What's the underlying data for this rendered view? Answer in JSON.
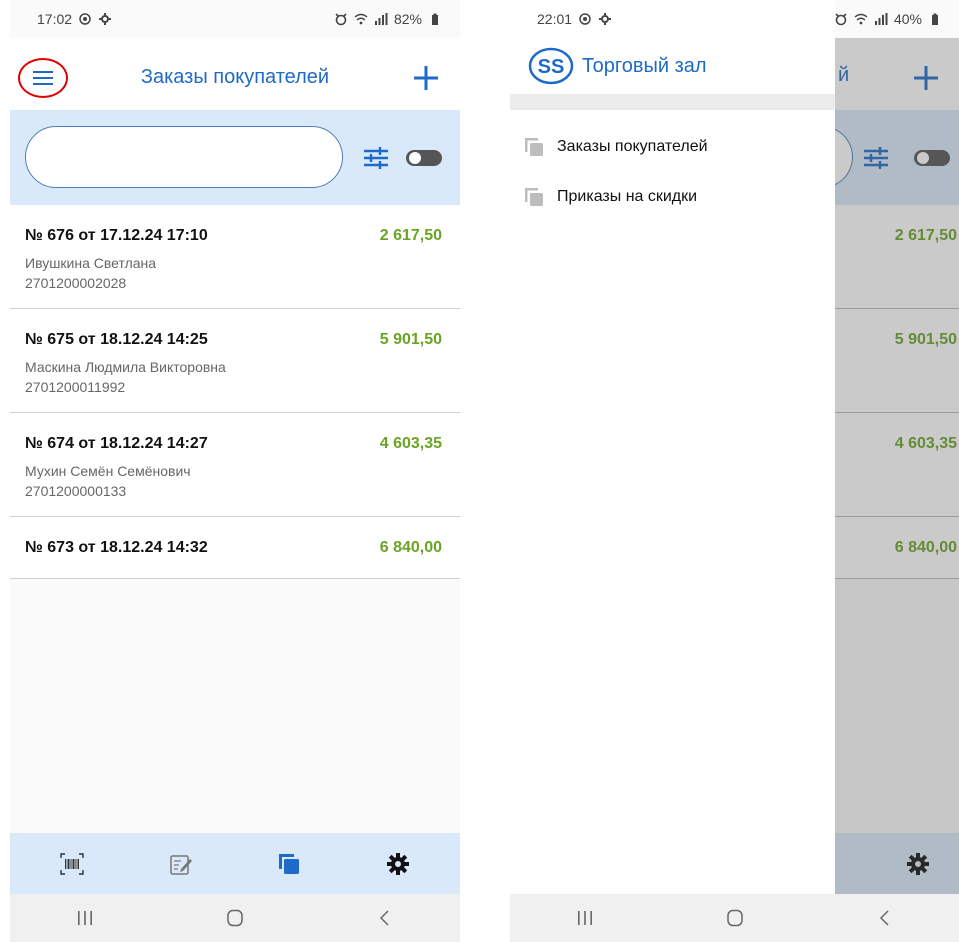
{
  "left_screen": {
    "status": {
      "time": "17:02",
      "battery": "82%"
    },
    "header": {
      "title": "Заказы покупателей"
    },
    "search": {
      "value": "",
      "placeholder": ""
    },
    "orders": [
      {
        "number": "№ 676 от 17.12.24 17:10",
        "sum": "2 617,50",
        "customer": "Ивушкина Светлана",
        "code": "2701200002028"
      },
      {
        "number": "№ 675 от 18.12.24 14:25",
        "sum": "5 901,50",
        "customer": "Маскина Людмила Викторовна",
        "code": "2701200011992"
      },
      {
        "number": "№ 674 от 18.12.24 14:27",
        "sum": "4 603,35",
        "customer": "Мухин Семён Семёнович",
        "code": "2701200000133"
      },
      {
        "number": "№ 673 от 18.12.24 14:32",
        "sum": "6 840,00",
        "customer": "",
        "code": ""
      }
    ],
    "bottom_bar": [
      "barcode-icon",
      "edit-note-icon",
      "documents-icon",
      "settings-icon"
    ]
  },
  "right_screen": {
    "status": {
      "time": "22:01",
      "battery": "40%"
    },
    "drawer": {
      "title": "Торговый зал",
      "logo_text": "SS",
      "items": [
        {
          "label": "Заказы покупателей"
        },
        {
          "label": "Приказы на скидки"
        }
      ]
    },
    "behind": {
      "title_fragment": "й",
      "sums": [
        "2 617,50",
        "5 901,50",
        "4 603,35",
        "6 840,00"
      ]
    }
  },
  "colors": {
    "accent": "#1e6ac8",
    "panel": "#d9e9fa",
    "sum": "#6aa424",
    "highlight": "#e10000"
  }
}
